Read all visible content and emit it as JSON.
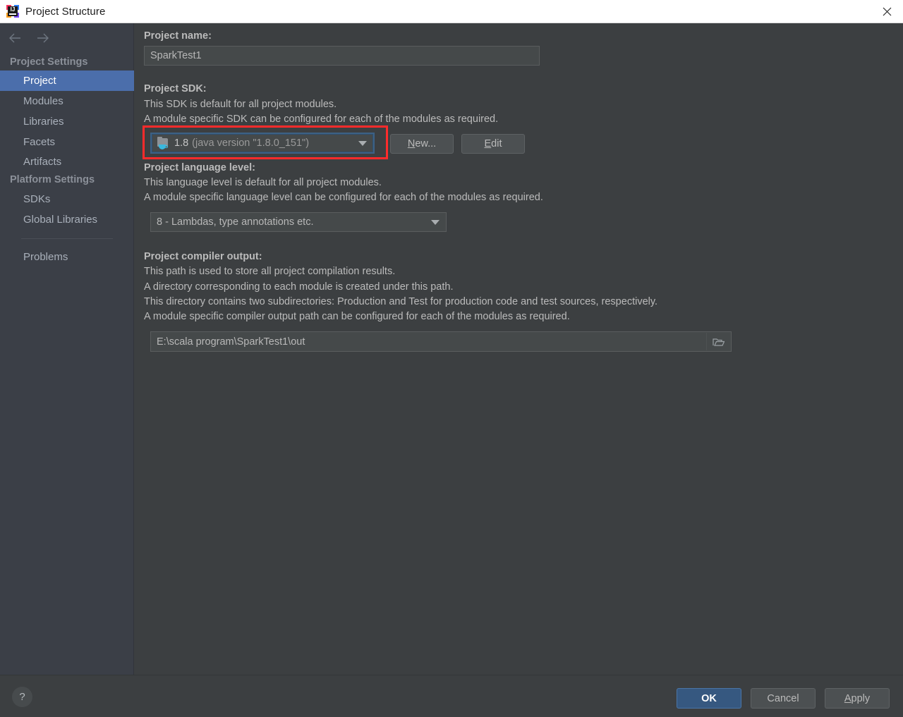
{
  "window": {
    "title": "Project Structure",
    "app_icon": "intellij-idea-logo",
    "close_icon": "close-icon"
  },
  "sidebar": {
    "nav": {
      "back_icon": "arrow-left-icon",
      "forward_icon": "arrow-right-icon"
    },
    "groups": [
      {
        "label": "Project Settings",
        "items": [
          "Project",
          "Modules",
          "Libraries",
          "Facets",
          "Artifacts"
        ]
      },
      {
        "label": "Platform Settings",
        "items": [
          "SDKs",
          "Global Libraries"
        ]
      }
    ],
    "extra_items": [
      "Problems"
    ],
    "selected": "Project"
  },
  "main": {
    "project_name": {
      "label": "Project name:",
      "value": "SparkTest1"
    },
    "project_sdk": {
      "label": "Project SDK:",
      "desc1": "This SDK is default for all project modules.",
      "desc2": "A module specific SDK can be configured for each of the modules as required.",
      "selected_name": "1.8",
      "selected_detail": "(java version \"1.8.0_151\")",
      "icon": "java-sdk-folder-icon",
      "new_button": "New...",
      "new_button_mnemonic": "N",
      "edit_button": "Edit",
      "edit_button_mnemonic": "E"
    },
    "language_level": {
      "label": "Project language level:",
      "desc1": "This language level is default for all project modules.",
      "desc2": "A module specific language level can be configured for each of the modules as required.",
      "value": "8 - Lambdas, type annotations etc."
    },
    "compiler_output": {
      "label": "Project compiler output:",
      "desc1": "This path is used to store all project compilation results.",
      "desc2": "A directory corresponding to each module is created under this path.",
      "desc3": "This directory contains two subdirectories: Production and Test for production code and test sources, respectively.",
      "desc4": "A module specific compiler output path can be configured for each of the modules as required.",
      "value": "E:\\scala program\\SparkTest1\\out",
      "browse_icon": "folder-browse-icon"
    }
  },
  "footer": {
    "help_label": "?",
    "ok": "OK",
    "cancel": "Cancel",
    "apply": "Apply",
    "apply_mnemonic": "A"
  },
  "annotation": {
    "kind": "red-rectangle-highlight",
    "target": "project-sdk-combobox"
  },
  "colors": {
    "titlebar_bg": "#ffffff",
    "sidebar_bg": "#3b3f47",
    "panel_bg": "#3c3f41",
    "selection_blue": "#4b6eab",
    "primary_button": "#365880",
    "annotation_red": "#ff2b2b",
    "field_bg": "#45494a"
  }
}
